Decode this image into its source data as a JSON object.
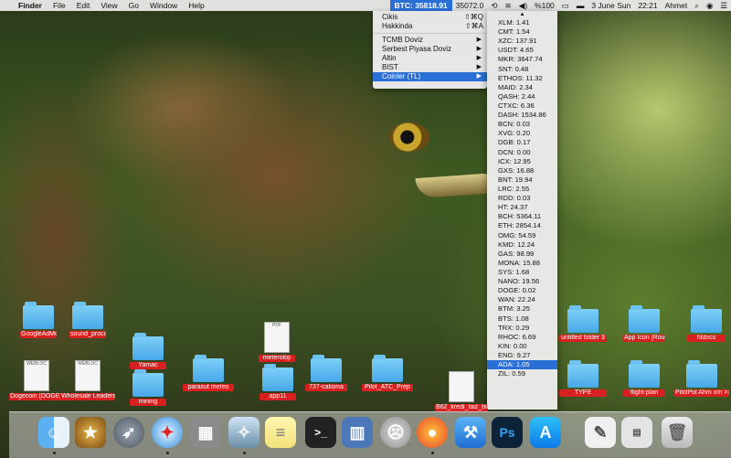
{
  "menubar": {
    "app": "Finder",
    "items": [
      "File",
      "Edit",
      "View",
      "Go",
      "Window",
      "Help"
    ],
    "btc": "BTC: 35818.91",
    "price2": "35072.0",
    "battery": "%100",
    "date": "3 June Sun",
    "time": "22:21",
    "user": "Ahmet"
  },
  "menu1": {
    "items": [
      {
        "label": "Cikis",
        "shortcut": "⇧⌘Q"
      },
      {
        "label": "Hakkinda",
        "shortcut": "⇧⌘A"
      },
      {
        "label": "TCMB Doviz",
        "submenu": true
      },
      {
        "label": "Serbest Piyasa Doviz",
        "submenu": true
      },
      {
        "label": "Altin",
        "submenu": true
      },
      {
        "label": "BIST",
        "submenu": true
      },
      {
        "label": "Coinler (TL)",
        "submenu": true,
        "selected": true
      }
    ]
  },
  "menu2": {
    "items": [
      "XLM: 1.41",
      "CMT: 1.54",
      "XZC: 137.91",
      "USDT: 4.65",
      "MKR: 3647.74",
      "SNT: 0.48",
      "ETHOS: 11.32",
      "MAID: 2.34",
      "QASH: 2.44",
      "CTXC: 6.36",
      "DASH: 1534.86",
      "BCN: 0.03",
      "XVG: 0.20",
      "DGB: 0.17",
      "DCN: 0.00",
      "ICX: 12.95",
      "GXS: 16.88",
      "BNT: 19.94",
      "LRC: 2.55",
      "RDD: 0.03",
      "HT: 24.37",
      "BCH: 5364.11",
      "ETH: 2854.14",
      "OMG: 54.59",
      "KMD: 12.24",
      "GAS: 98.99",
      "MONA: 15.88",
      "SYS: 1.68",
      "NANO: 19.56",
      "DOGE: 0.02",
      "WAN: 22.24",
      "BTM: 3.25",
      "BTS: 1.08",
      "TRX: 0.29",
      "RHOC: 6.69",
      "KIN: 0.00",
      "ENG: 9.27",
      "ADA: 1.05",
      "ZIL: 0.59"
    ],
    "selected_index": 37
  },
  "desktop": {
    "labels": [
      "GoogleAdMobAds SdkiOS",
      "sound_proccessing",
      "Dogecoin (DOGE) price_ch...rketCap",
      "Wholesale Leadershi...Directory",
      "Yamac",
      "mining",
      "parasut meteo",
      "meteroloji",
      "app11",
      "737-calisma",
      "Pilot_ATC_Prep",
      "B62_kredi_faiz_bil",
      "untitled folder 3",
      "App Icon [Rounded]",
      "htdocs",
      "TYPE",
      "flight-plan",
      "PilotPol Ahm om >> Pilot.......webloc"
    ]
  },
  "dock": {
    "apps": [
      "Finder",
      "Launchpad",
      "Safari",
      "Calculator",
      "Preview",
      "Notes",
      "Terminal",
      "Piles",
      "Migration",
      "Firefox",
      "Xcode",
      "Photoshop",
      "App Store",
      "TextEdit",
      "MAMP",
      "Trash"
    ]
  }
}
